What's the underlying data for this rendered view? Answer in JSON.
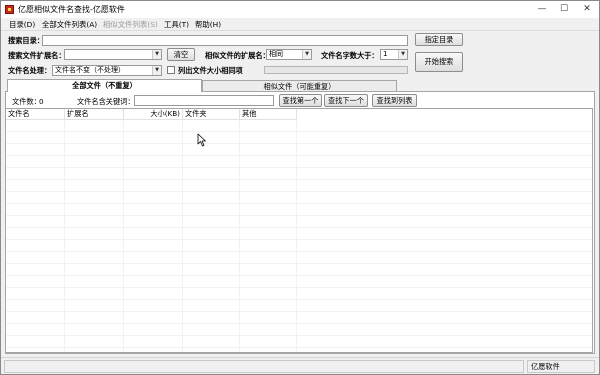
{
  "window": {
    "title": "亿愿相似文件名查找-亿愿软件",
    "controls": {
      "minimize": "—",
      "maximize": "☐",
      "close": "✕"
    }
  },
  "menu": [
    {
      "label": "目录(D)",
      "enabled": true
    },
    {
      "label": "全部文件列表(A)",
      "enabled": true
    },
    {
      "label": "相似文件列表(S)",
      "enabled": false
    },
    {
      "label": "工具(T)",
      "enabled": true
    },
    {
      "label": "帮助(H)",
      "enabled": true
    }
  ],
  "form": {
    "search_dir_label": "搜索目录：",
    "search_dir_value": "",
    "choose_dir_button": "指定目录",
    "ext_label": "搜索文件扩展名：",
    "ext_value": "",
    "clear_button": "清空",
    "similar_ext_label": "相似文件的扩展名：",
    "similar_ext_value": "相同",
    "name_len_label": "文件名字数大于：",
    "name_len_value": "1",
    "start_button": "开始搜索",
    "name_handling_label": "文件名处理：",
    "name_handling_value": "文件名不变（不处理）",
    "list_same_size_label": "列出文件大小相同项",
    "list_same_size_checked": false,
    "progress": 0
  },
  "tabs": [
    {
      "label": "全部文件（不重复）",
      "active": true
    },
    {
      "label": "相似文件（可能重复）",
      "active": false
    }
  ],
  "tab_toolbar": {
    "file_count_label": "文件数：",
    "file_count_value": "0",
    "keyword_label": "文件名含关键词：",
    "keyword_value": "",
    "find_first": "查找第一个",
    "find_next": "查找下一个",
    "find_to_list": "查找到列表"
  },
  "list": {
    "columns": [
      "文件名",
      "扩展名",
      "大小(KB)",
      "文件夹",
      "其他"
    ],
    "rows": []
  },
  "status": {
    "left": "",
    "right": "亿愿软件"
  },
  "colors": {
    "progress_fill": "#06b025",
    "app_icon": "#c52a1a"
  }
}
